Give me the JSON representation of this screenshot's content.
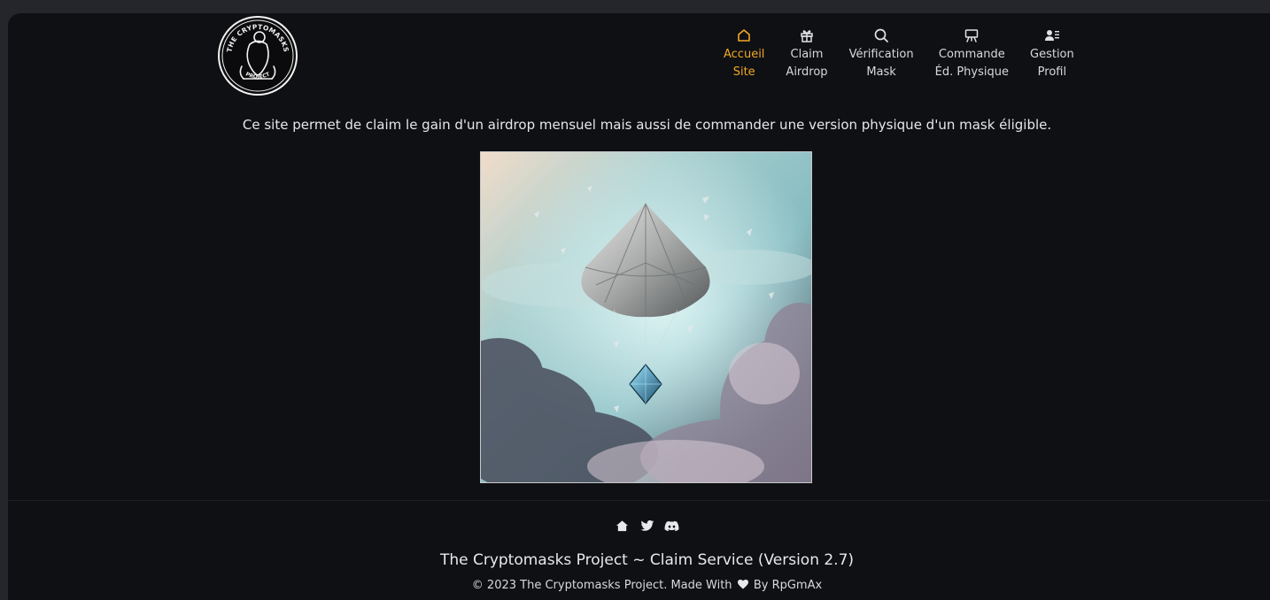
{
  "header": {
    "logo": {
      "text_top": "THE CRYPTOMASKS",
      "text_bottom": "PROJECT",
      "icon": "mask-logo-icon"
    },
    "nav": [
      {
        "icon": "home-icon",
        "line1": "Accueil",
        "line2": "Site",
        "active": true
      },
      {
        "icon": "gift-icon",
        "line1": "Claim",
        "line2": "Airdrop",
        "active": false
      },
      {
        "icon": "search-icon",
        "line1": "Vérification",
        "line2": "Mask",
        "active": false
      },
      {
        "icon": "easel-icon",
        "line1": "Commande",
        "line2": "Éd. Physique",
        "active": false
      },
      {
        "icon": "user-card-icon",
        "line1": "Gestion",
        "line2": "Profil",
        "active": false
      }
    ]
  },
  "main": {
    "intro": "Ce site permet de claim le gain d'un airdrop mensuel mais aussi de commander une version physique d'un mask éligible.",
    "hero_icon": "airdrop-illustration"
  },
  "footer": {
    "social": [
      "home-icon",
      "twitter-icon",
      "discord-icon"
    ],
    "title": "The Cryptomasks Project ~ Claim Service (Version 2.7)",
    "copy_before": "© 2023 The Cryptomasks Project. Made With",
    "copy_after": "By RpGmAx"
  },
  "colors": {
    "accent": "#f0a826",
    "background": "#0f1014",
    "frame": "#25262b",
    "text": "#e7e7ea"
  }
}
